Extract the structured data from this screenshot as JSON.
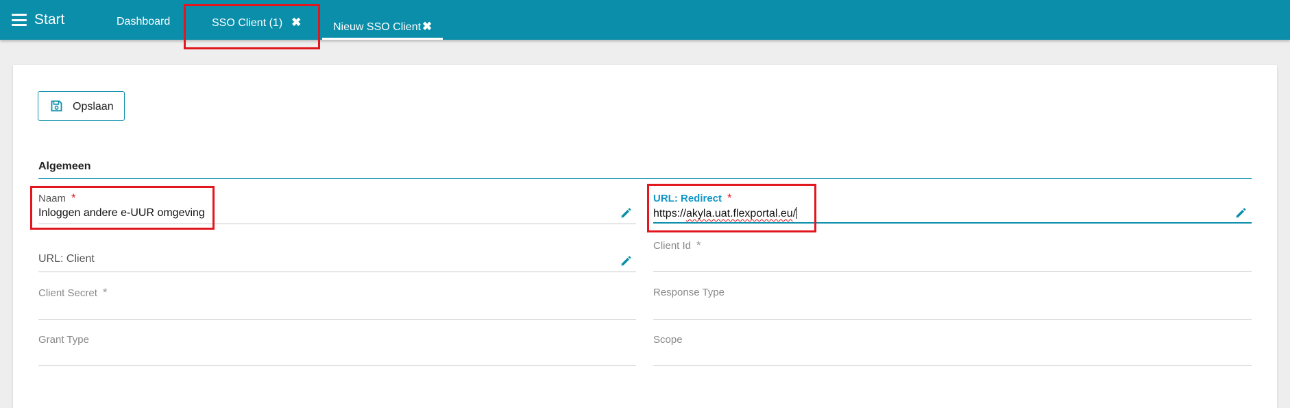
{
  "header": {
    "menu_label": "Start",
    "tabs": [
      {
        "label": "Dashboard"
      },
      {
        "label": "SSO Client (1)",
        "close": "✖"
      },
      {
        "label": "Nieuw SSO Client",
        "close": "✖"
      }
    ]
  },
  "toolbar": {
    "save_label": "Opslaan"
  },
  "form": {
    "section_title": "Algemeen",
    "required_marker": "*",
    "fields": {
      "naam": {
        "label": "Naam",
        "value": "Inloggen andere e-UUR omgeving"
      },
      "url_redirect": {
        "label": "URL: Redirect",
        "value_prefix": "https://",
        "value_main": "akyla.uat.flexportal.eu",
        "value_suffix": "/"
      },
      "url_client": {
        "label": "URL: Client",
        "value": ""
      },
      "client_id": {
        "label": "Client Id",
        "value": ""
      },
      "client_secret": {
        "label": "Client Secret",
        "value": ""
      },
      "response_type": {
        "label": "Response Type",
        "value": ""
      },
      "grant_type": {
        "label": "Grant Type",
        "value": ""
      },
      "scope": {
        "label": "Scope",
        "value": ""
      }
    }
  },
  "colors": {
    "header_bg": "#0a8eaa",
    "accent": "#0a8eaa",
    "required": "#e2161e",
    "highlight_box": "#e2161e",
    "active_label": "#1196c6"
  },
  "icons": {
    "menu": "hamburger-icon",
    "save": "floppy-disk-icon",
    "edit": "pencil-icon",
    "close": "close-icon"
  }
}
